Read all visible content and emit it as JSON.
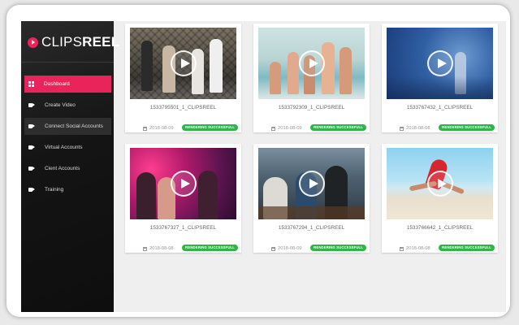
{
  "app": {
    "logo_prefix": "CLIPS",
    "logo_suffix": "REEL"
  },
  "sidebar": {
    "items": [
      {
        "label": "Dashboard",
        "icon": "dashboard-icon",
        "active": true
      },
      {
        "label": "Create Video",
        "icon": "video-camera-icon"
      },
      {
        "label": "Connect Social Accounts",
        "icon": "video-camera-icon"
      },
      {
        "label": "Virtual Accounts",
        "icon": "video-camera-icon"
      },
      {
        "label": "Cient Accounts",
        "icon": "video-camera-icon"
      },
      {
        "label": "Training",
        "icon": "video-camera-icon"
      }
    ]
  },
  "videos": [
    {
      "title": "1533795501_1_CLIPSREEL",
      "date": "2018-08-09",
      "status": "RENDERING SUCCESSFULL"
    },
    {
      "title": "1533792309_1_CLIPSREEL",
      "date": "2018-08-09",
      "status": "RENDERING SUCCESSFULL"
    },
    {
      "title": "1533767432_1_CLIPSREEL",
      "date": "2018-08-08",
      "status": "RENDERING SUCCESSFULL"
    },
    {
      "title": "1533767327_1_CLIPSREEL",
      "date": "2018-08-08",
      "status": "RENDERING SUCCESSFULL"
    },
    {
      "title": "1533767294_1_CLIPSREEL",
      "date": "2018-08-09",
      "status": "RENDERING SUCCESSFULL"
    },
    {
      "title": "1533766642_1_CLIPSREEL",
      "date": "2018-08-08",
      "status": "RENDERING SUCCESSFULL"
    }
  ],
  "colors": {
    "accent": "#e8245a",
    "success": "#2fb34a",
    "sidebar": "#141414"
  }
}
